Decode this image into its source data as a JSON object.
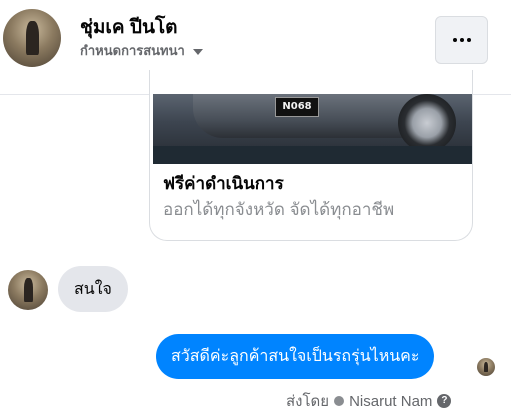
{
  "header": {
    "contact_name": "ชุ่มเค ปีนโต",
    "subtitle": "กำหนดการสนทนา",
    "menu_icon": "more-horizontal-icon"
  },
  "card": {
    "plate_text": "N068",
    "title": "ฟรีค่าดำเนินการ",
    "subtitle": "ออกได้ทุกจังหวัด จัดได้ทุกอาชีพ"
  },
  "messages": {
    "incoming": "สนใจ",
    "outgoing": "สวัสดีค่ะลูกค้าสนใจเป็นรถรุ่นไหนคะ"
  },
  "footer": {
    "sent_by_label": "ส่งโดย",
    "agent_name": "Nisarut Nam",
    "help_glyph": "?"
  },
  "colors": {
    "outgoing_bubble": "#0084ff",
    "incoming_bubble": "#e4e6eb",
    "secondary_text": "#65676b"
  }
}
